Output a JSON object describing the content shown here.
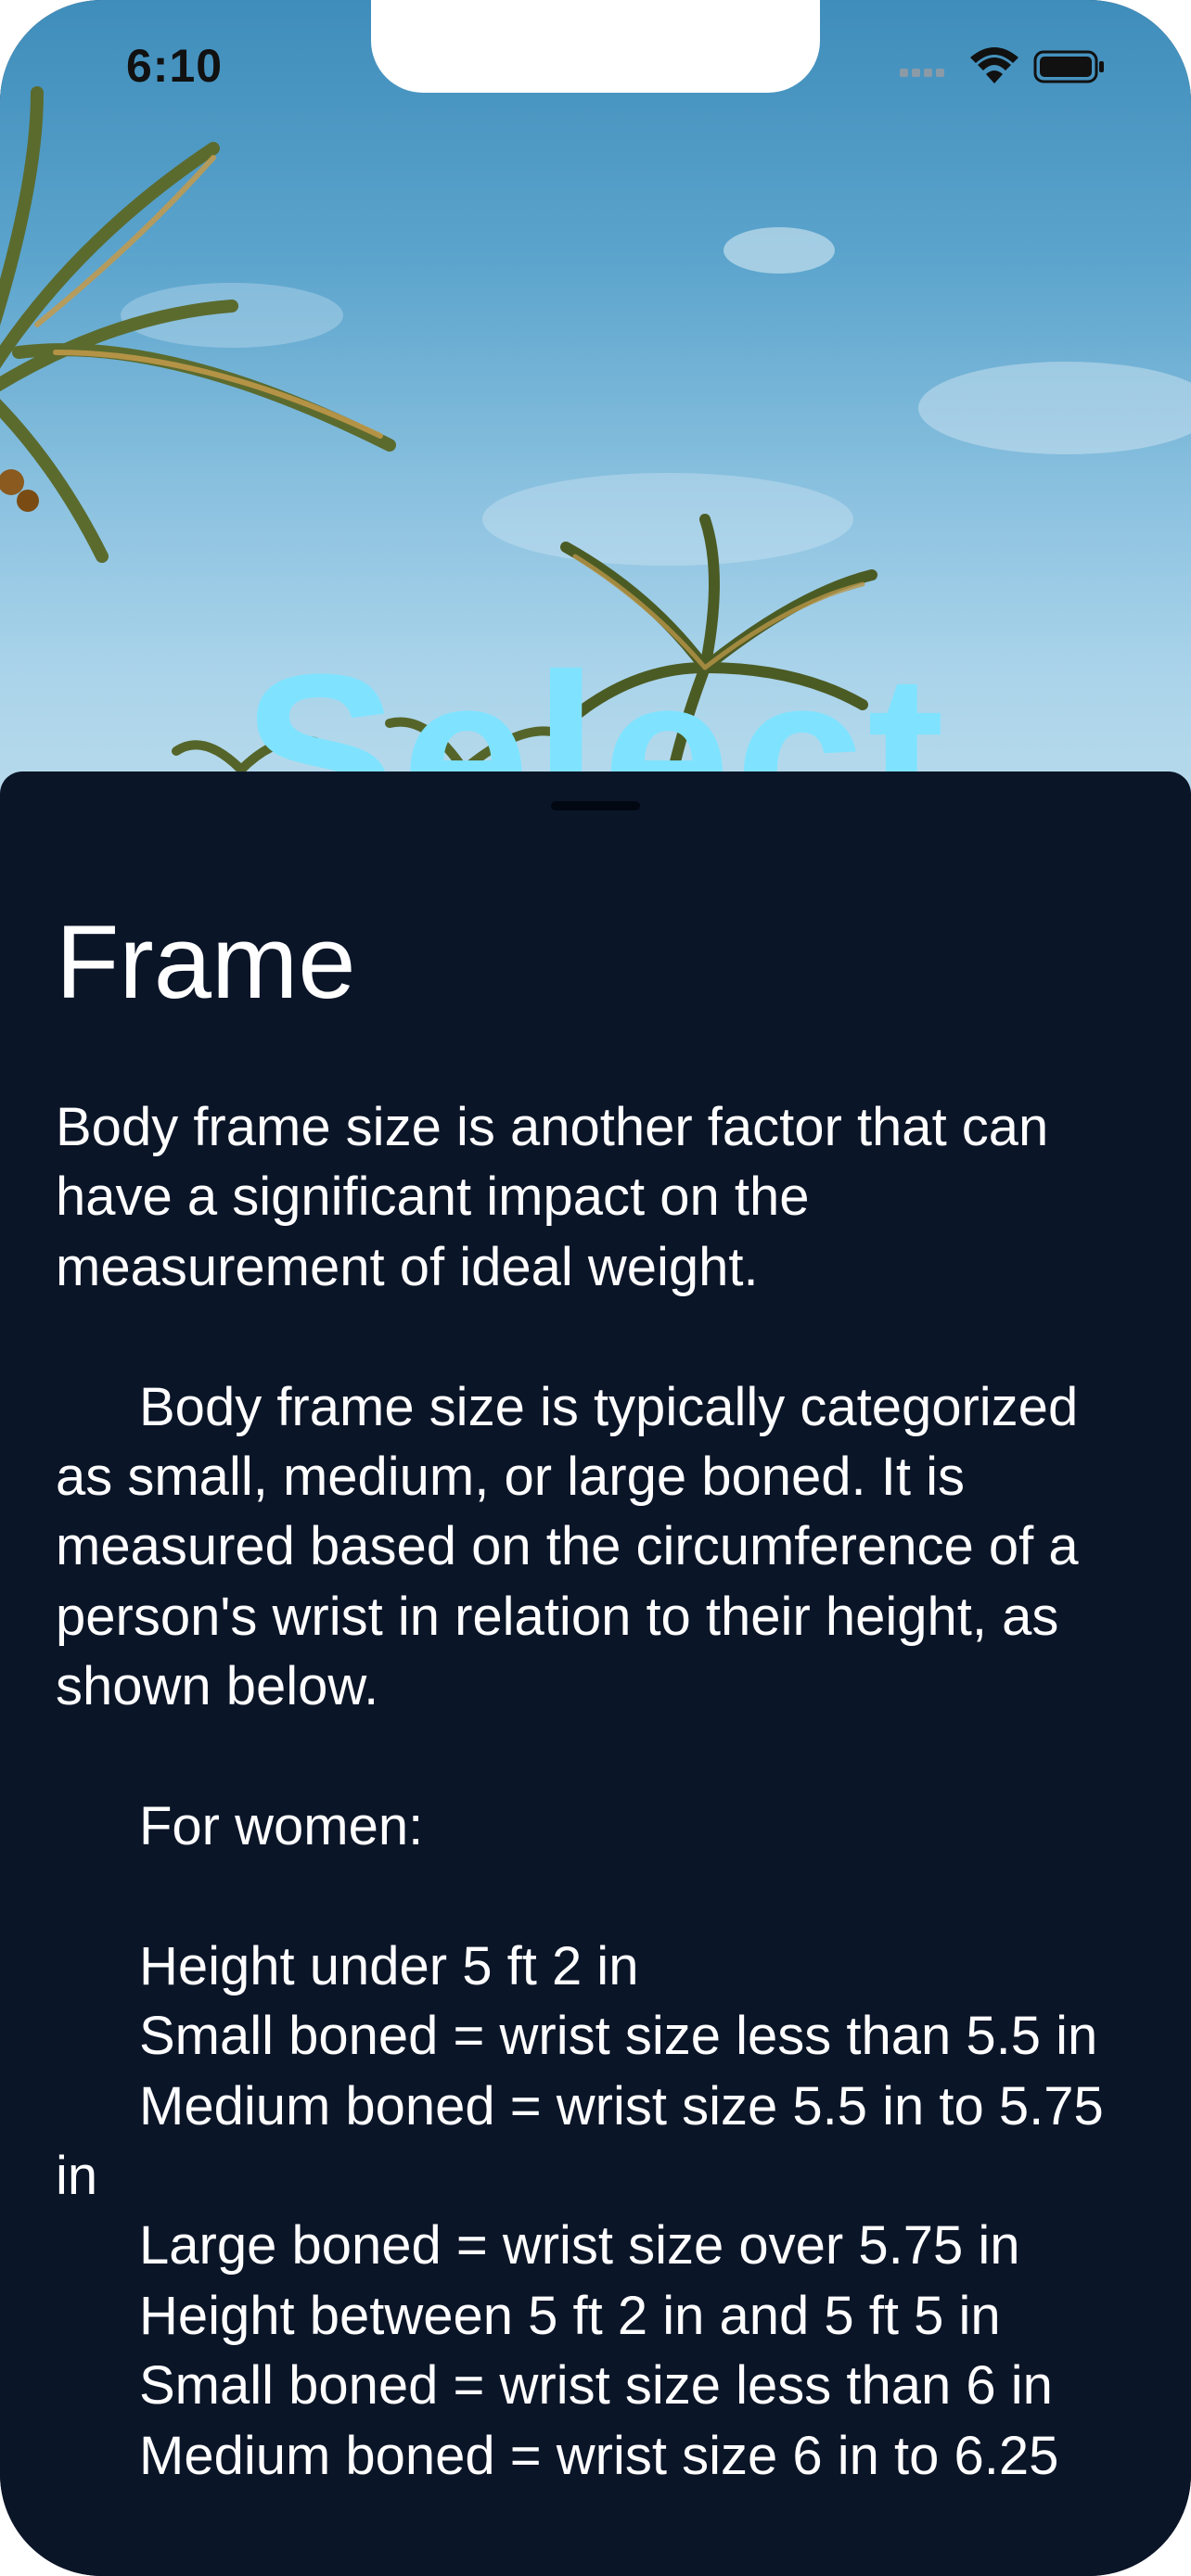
{
  "status_bar": {
    "time": "6:10"
  },
  "background": {
    "title_partial": "Select"
  },
  "sheet": {
    "title": "Frame",
    "paragraph_1": "Body frame size is another factor that can have a significant impact on the measurement of ideal weight.",
    "paragraph_2": "Body frame size is typically categorized as small, medium, or large boned. It is measured based on the circumference of a person's wrist in relation to their height, as shown below.",
    "for_women": "For women:",
    "lines": [
      "Height under 5 ft 2 in",
      "Small boned = wrist size less than 5.5 in",
      "Medium boned = wrist size 5.5 in to 5.75 in",
      "Large boned = wrist size over 5.75 in",
      "Height between 5 ft 2 in and 5 ft 5 in",
      "Small boned = wrist size less than 6 in",
      "Medium boned = wrist size 6 in to 6.25"
    ]
  }
}
